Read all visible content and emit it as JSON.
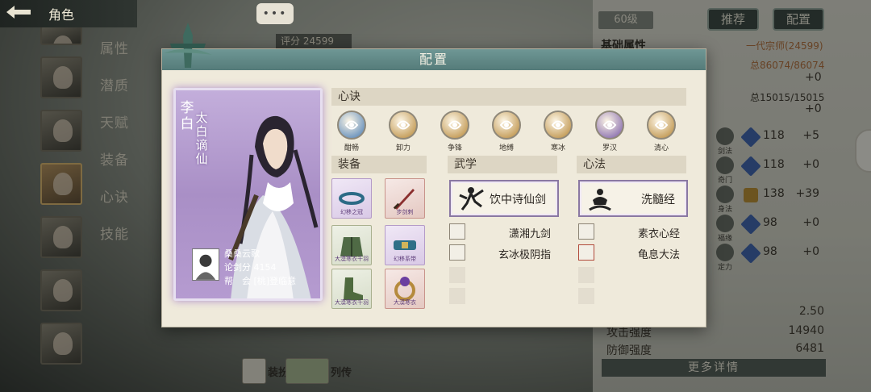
{
  "topbar": {
    "title": "角色"
  },
  "menu": [
    "属性",
    "潜质",
    "天赋",
    "装备",
    "心诀",
    "技能"
  ],
  "chat": {
    "label": "•••"
  },
  "background": {
    "score_label": "评分",
    "score_value": "24599",
    "level": "60级",
    "recommend": "推荐",
    "config": "配置",
    "basic_attr": "基础属性",
    "sect_title": "一代宗师(24599)",
    "hp": "总86074/86074",
    "hp_bonus": "+0",
    "mp": "总15015/15015",
    "mp_bonus": "+0",
    "stats": [
      {
        "label": "剑法",
        "value": "118",
        "bonus": "+5"
      },
      {
        "label": "奇门",
        "value": "118",
        "bonus": "+0"
      },
      {
        "label": "身法",
        "value": "138",
        "bonus": "+39"
      },
      {
        "label": "福缘",
        "value": "98",
        "bonus": "+0"
      },
      {
        "label": "定力",
        "value": "98",
        "bonus": "+0"
      }
    ],
    "lower": [
      {
        "label": "",
        "value": "2.50"
      },
      {
        "label": "攻击强度",
        "value": "14940"
      },
      {
        "label": "防御强度",
        "value": "6481"
      }
    ],
    "more_details": "更多详情",
    "outfit": "装扮",
    "biography": "列传"
  },
  "modal": {
    "title": "配置",
    "character": {
      "name": "李白",
      "title": "太白谪仙",
      "player": "桑桑云歌",
      "score": "论剑分 4154",
      "guild": "帮　会 [桃]登临意"
    },
    "xinjue_header": "心诀",
    "xinjue": [
      {
        "label": "酣畅",
        "color": "#4d7fb5"
      },
      {
        "label": "卸力",
        "color": "#b88a3c"
      },
      {
        "label": "争锋",
        "color": "#b88a3c"
      },
      {
        "label": "地缚",
        "color": "#b88a3c"
      },
      {
        "label": "寒冰",
        "color": "#b88a3c"
      },
      {
        "label": "罗汉",
        "color": "#7b5da8"
      },
      {
        "label": "清心",
        "color": "#b88a3c"
      }
    ],
    "equip_header": "装备",
    "equipment": [
      {
        "label": "幻移之冠",
        "rarity": "purple",
        "icon": "crown-icon"
      },
      {
        "label": "步剑刺",
        "rarity": "red",
        "icon": "dagger-icon"
      },
      {
        "label": "大漠寒衣千羽",
        "rarity": "green",
        "icon": "robe-icon"
      },
      {
        "label": "幻移系带",
        "rarity": "purple",
        "icon": "belt-icon"
      },
      {
        "label": "大漠寒衣千羽",
        "rarity": "green",
        "icon": "boots-icon"
      },
      {
        "label": "大漠寒衣",
        "rarity": "red",
        "icon": "ring-icon"
      }
    ],
    "wuxue_header": "武学",
    "wuxue_main": "饮中诗仙剑",
    "wuxue_sub": [
      "潇湘九剑",
      "玄冰极阴指"
    ],
    "xinfa_header": "心法",
    "xinfa_main": "洗髓经",
    "xinfa_sub": [
      "素衣心经",
      "龟息大法"
    ]
  }
}
